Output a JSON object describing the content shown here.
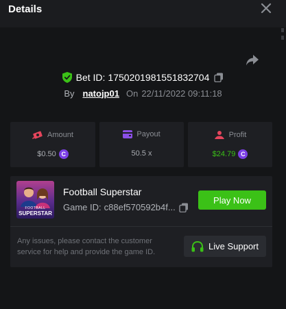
{
  "header": {
    "title": "Details",
    "close_icon": "close-icon"
  },
  "bet": {
    "label": "Bet ID:",
    "id": "1750201981551832704",
    "by_label": "By",
    "user": "natojp01",
    "on_label": "On",
    "datetime": "22/11/2022 09:11:18"
  },
  "stats": [
    {
      "label": "Amount",
      "value": "$0.50",
      "icon": "money-icon"
    },
    {
      "label": "Payout",
      "value": "50.5 x",
      "icon": "wallet-icon"
    },
    {
      "label": "Profit",
      "value": "$24.79",
      "icon": "profit-icon"
    }
  ],
  "game": {
    "thumb_text_top": "FOOTBALL",
    "thumb_text_main": "SUPERSTAR",
    "title": "Football Superstar",
    "id_label": "Game ID:",
    "id_value": "c88ef570592b4f...",
    "play_label": "Play Now",
    "help_text": "Any issues, please contact the customer service for help and provide the game ID.",
    "support_label": "Live Support"
  },
  "colors": {
    "background": "#141517",
    "panel": "#1e1f23",
    "accent_green": "#3bc117",
    "profit_green": "#3bc117",
    "coin_purple": "#7b3fe4",
    "link_white": "#ffffff"
  },
  "coin_symbol": "C"
}
